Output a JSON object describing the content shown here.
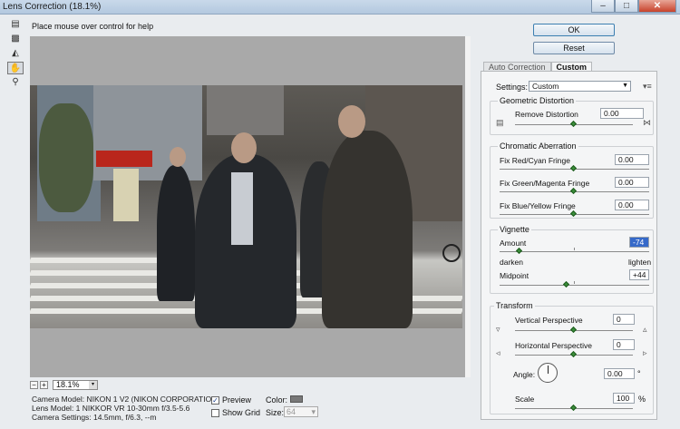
{
  "window": {
    "title": "Lens Correction (18.1%)",
    "controls": [
      "–",
      "□",
      "✕"
    ]
  },
  "help": {
    "text": "Place mouse over control for help"
  },
  "tools": [
    "remove-distortion-tool",
    "straighten-tool",
    "move-grid-tool",
    "hand-tool",
    "zoom-tool"
  ],
  "zoom": {
    "minus": "−",
    "plus": "+",
    "value": "18.1%",
    "dropdown": "▾"
  },
  "camera_info": {
    "model": "Camera Model: NIKON 1 V2 (NIKON CORPORATION)",
    "lens": "Lens Model: 1 NIKKOR VR 10-30mm f/3.5-5.6",
    "settings": "Camera Settings: 14.5mm, f/6.3, --m"
  },
  "preview_options": {
    "preview_label": "Preview",
    "preview_checked": true,
    "grid_label": "Show Grid",
    "grid_checked": false,
    "color_label": "Color:",
    "size_label": "Size:",
    "size_value": "64",
    "grid_color": "#787878"
  },
  "buttons": {
    "ok": "OK",
    "reset": "Reset"
  },
  "tabs": [
    {
      "label": "Auto Correction",
      "active": false
    },
    {
      "label": "Custom",
      "active": true
    }
  ],
  "custom": {
    "settings_label": "Settings:",
    "settings_value": "Custom",
    "settings_menu_icon": "▾≡",
    "geometric": {
      "title": "Geometric Distortion",
      "remove_label": "Remove Distortion",
      "remove_value": "0.00",
      "remove_level": 0.5
    },
    "chromatic": {
      "title": "Chromatic Aberration",
      "red_cyan_label": "Fix Red/Cyan Fringe",
      "red_cyan_value": "0.00",
      "green_magenta_label": "Fix Green/Magenta Fringe",
      "green_magenta_value": "0.00",
      "blue_yellow_label": "Fix Blue/Yellow Fringe",
      "blue_yellow_value": "0.00"
    },
    "vignette": {
      "title": "Vignette",
      "amount_label": "Amount",
      "amount_value": "-74",
      "amount_level": 0.13,
      "darken_label": "darken",
      "lighten_label": "lighten",
      "midpoint_label": "Midpoint",
      "midpoint_value": "+44",
      "midpoint_level": 0.44
    },
    "transform": {
      "title": "Transform",
      "vertical_label": "Vertical Perspective",
      "vertical_value": "0",
      "horizontal_label": "Horizontal Perspective",
      "horizontal_value": "0",
      "angle_label": "Angle:",
      "angle_value": "0.00",
      "angle_unit": "°",
      "scale_label": "Scale",
      "scale_value": "100",
      "scale_unit": "%"
    }
  },
  "colors": {
    "accent": "#3569c9",
    "slider_thumb": "#3a8d3a",
    "preview_background": "#a9a9a9"
  }
}
